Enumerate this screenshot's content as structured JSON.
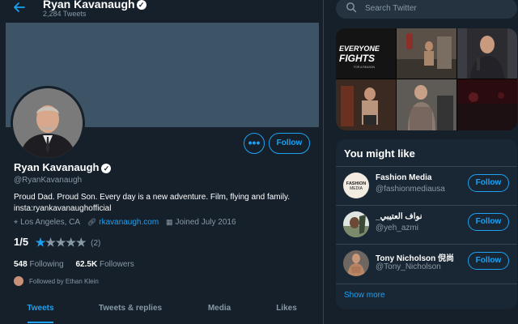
{
  "header": {
    "name": "Ryan Kavanaugh",
    "tweet_count": "2,284 Tweets",
    "back_icon": "arrow-left-icon"
  },
  "profile": {
    "name": "Ryan Kavanaugh",
    "handle": "@RyanKavanaugh",
    "bio_line1": "Proud Dad. Proud Son. Every day is a new adventure. Film, flying and family.",
    "bio_line2": "insta:ryankavanaughofficial",
    "location": "Los Angeles, CA",
    "website": "rkavanaugh.com",
    "joined": "Joined July 2016",
    "follow_label": "Follow",
    "more_label": "•••"
  },
  "rating": {
    "score": "1/5",
    "stars_filled": 1,
    "stars_total": 5,
    "count": "(2)"
  },
  "counts": {
    "following_value": "548",
    "following_label": "Following",
    "followers_value": "62.5K",
    "followers_label": "Followers"
  },
  "followed_by": "Followed by Ethan Klein",
  "tabs": [
    {
      "label": "Tweets",
      "active": true
    },
    {
      "label": "Tweets & replies",
      "active": false
    },
    {
      "label": "Media",
      "active": false
    },
    {
      "label": "Likes",
      "active": false
    }
  ],
  "search": {
    "placeholder": "Search Twitter"
  },
  "media_text": {
    "line1": "EVERYONE",
    "line2": "FIGHTS",
    "line3": "FOR A REASON"
  },
  "might_like": {
    "title": "You might like",
    "items": [
      {
        "name": "Fashion Media",
        "handle": "@fashionmediausa",
        "follow": "Follow",
        "avatar_text": "FASHION MEDIA"
      },
      {
        "name": "_نواف العتيبي",
        "handle": "@yeh_azmi",
        "follow": "Follow"
      },
      {
        "name": "Tony Nicholson 倪尚",
        "handle": "@Tony_Nicholson",
        "follow": "Follow"
      }
    ],
    "show_more": "Show more"
  },
  "colors": {
    "background": "#15202b",
    "accent": "#1da1f2",
    "muted": "#8899a6",
    "banner": "#3d5466"
  }
}
